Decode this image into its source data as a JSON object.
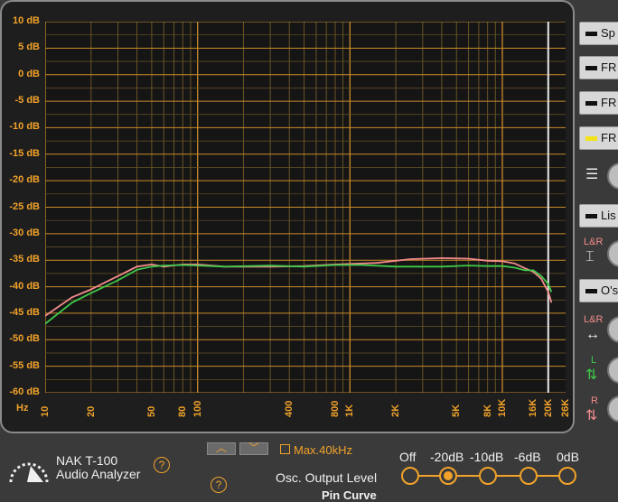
{
  "chart_data": {
    "type": "line",
    "y_ticks": [
      "10 dB",
      "5 dB",
      "0 dB",
      "-5 dB",
      "-10 dB",
      "-15 dB",
      "-20 dB",
      "-25 dB",
      "-30 dB",
      "-35 dB",
      "-40 dB",
      "-45 dB",
      "-50 dB",
      "-55 dB",
      "-60 dB"
    ],
    "ylim": [
      -60,
      10
    ],
    "x_unit": "Hz",
    "x_tick_labels": [
      {
        "f": 10,
        "t": "10"
      },
      {
        "f": 20,
        "t": "20"
      },
      {
        "f": 50,
        "t": "50"
      },
      {
        "f": 80,
        "t": "80"
      },
      {
        "f": 100,
        "t": "100"
      },
      {
        "f": 400,
        "t": "400"
      },
      {
        "f": 800,
        "t": "800"
      },
      {
        "f": 1000,
        "t": "1K"
      },
      {
        "f": 2000,
        "t": "2K"
      },
      {
        "f": 5000,
        "t": "5K"
      },
      {
        "f": 8000,
        "t": "8K"
      },
      {
        "f": 10000,
        "t": "10K"
      },
      {
        "f": 16000,
        "t": "16K"
      },
      {
        "f": 20000,
        "t": "20K"
      },
      {
        "f": 26000,
        "t": "26K"
      }
    ],
    "xlim": [
      10,
      26000
    ],
    "x_scale": "log",
    "marker_f": 20000,
    "series": [
      {
        "color": "#f28c8c",
        "points": [
          [
            10,
            -45.5
          ],
          [
            15,
            -42
          ],
          [
            20,
            -40.5
          ],
          [
            30,
            -38
          ],
          [
            40,
            -36.2
          ],
          [
            50,
            -35.8
          ],
          [
            60,
            -36.2
          ],
          [
            80,
            -35.8
          ],
          [
            100,
            -35.8
          ],
          [
            150,
            -36.2
          ],
          [
            300,
            -36.2
          ],
          [
            500,
            -36.1
          ],
          [
            800,
            -35.8
          ],
          [
            1500,
            -35.5
          ],
          [
            2500,
            -34.8
          ],
          [
            4000,
            -34.6
          ],
          [
            6000,
            -34.7
          ],
          [
            8000,
            -35.1
          ],
          [
            10000,
            -35.2
          ],
          [
            12000,
            -35.6
          ],
          [
            14000,
            -36.5
          ],
          [
            16000,
            -37.2
          ],
          [
            18000,
            -38.5
          ],
          [
            20000,
            -41
          ],
          [
            21000,
            -43
          ]
        ]
      },
      {
        "color": "#3ec94a",
        "points": [
          [
            10,
            -47
          ],
          [
            15,
            -43
          ],
          [
            20,
            -41.2
          ],
          [
            30,
            -38.8
          ],
          [
            40,
            -36.8
          ],
          [
            50,
            -36.2
          ],
          [
            60,
            -36
          ],
          [
            80,
            -35.9
          ],
          [
            100,
            -36
          ],
          [
            150,
            -36.2
          ],
          [
            300,
            -36
          ],
          [
            500,
            -36.2
          ],
          [
            800,
            -35.9
          ],
          [
            1200,
            -35.9
          ],
          [
            2000,
            -36.2
          ],
          [
            4000,
            -36.2
          ],
          [
            6000,
            -36
          ],
          [
            8000,
            -36.1
          ],
          [
            10000,
            -36.1
          ],
          [
            12000,
            -36.4
          ],
          [
            14000,
            -36.9
          ],
          [
            16000,
            -36.9
          ],
          [
            18000,
            -38
          ],
          [
            20000,
            -39.5
          ],
          [
            21000,
            -41
          ]
        ]
      }
    ]
  },
  "right_panel": {
    "btn_sp": "Sp",
    "btn_fr1": "FR",
    "btn_fr2": "FR",
    "btn_fr3": "FR",
    "btn_lis": "Lis",
    "btn_os": "O's",
    "lr_label": "L&R",
    "l_label": "L",
    "r_label": "R",
    "accent_yellow": "#f3e31a"
  },
  "bottom": {
    "brand_line1": "NAK T-100",
    "brand_line2": "Audio Analyzer",
    "help_mark": "?",
    "max_label": "Max.40kHz",
    "osc_label": "Osc. Output Level",
    "osc_options": [
      "Off",
      "-20dB",
      "-10dB",
      "-6dB",
      "0dB"
    ],
    "osc_selected_index": 1,
    "pin_label": "Pin Curve"
  },
  "colors": {
    "accent": "#f0a22a",
    "grid_major": "#c98b2a",
    "grid_minor": "#6b5426"
  }
}
